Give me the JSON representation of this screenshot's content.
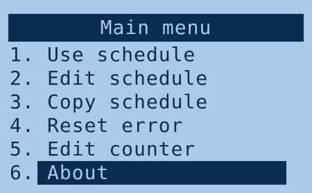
{
  "menu": {
    "title": "Main menu",
    "items": [
      {
        "num": "1.",
        "label": "Use schedule",
        "selected": false
      },
      {
        "num": "2.",
        "label": "Edit schedule",
        "selected": false
      },
      {
        "num": "3.",
        "label": "Copy schedule",
        "selected": false
      },
      {
        "num": "4.",
        "label": "Reset error",
        "selected": false
      },
      {
        "num": "5.",
        "label": "Edit counter",
        "selected": false
      },
      {
        "num": "6.",
        "label": "About",
        "selected": true
      }
    ]
  },
  "colors": {
    "background": "#a9cbe9",
    "foreground": "#0b2e4e"
  }
}
